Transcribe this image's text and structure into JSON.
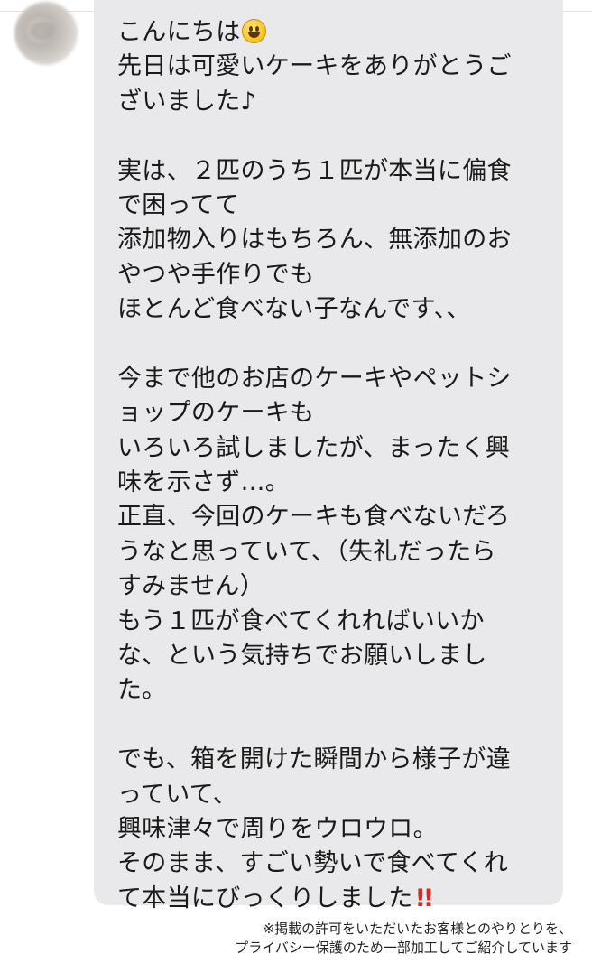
{
  "message": {
    "lines": [
      "こんにちは",
      "先日は可愛いケーキをありがとうご",
      "ざいました♪",
      "",
      "実は、２匹のうち１匹が本当に偏食",
      "で困ってて",
      "添加物入りはもちろん、無添加のお",
      "やつや手作りでも",
      "ほとんど食べない子なんです、、",
      "",
      "今まで他のお店のケーキやペットシ",
      "ョップのケーキも",
      "いろいろ試しましたが、まったく興",
      "味を示さず…。",
      "正直、今回のケーキも食べないだろ",
      "うなと思っていて、（失礼だったら",
      "すみません）",
      "もう１匹が食べてくれればいいか",
      "な、という気持ちでお願いしまし",
      "た。",
      "",
      "でも、箱を開けた瞬間から様子が違",
      "っていて、",
      "興味津々で周りをウロウロ。",
      "そのまま、すごい勢いで食べてくれ",
      "て本当にびっくりしました"
    ],
    "first_line_emoji": "smiling-face-emoji",
    "last_line_emoji": "double-exclamation-mark-emoji",
    "last_line_emoji_glyph": "!!",
    "bubble_color": "#e9e9eb",
    "emoji_red": "#e0241b"
  },
  "caption": {
    "line1": "※掲載の許可をいただいたお客様とのやりとりを、",
    "line2": "プライバシー保護のため一部加工してご紹介しています"
  }
}
